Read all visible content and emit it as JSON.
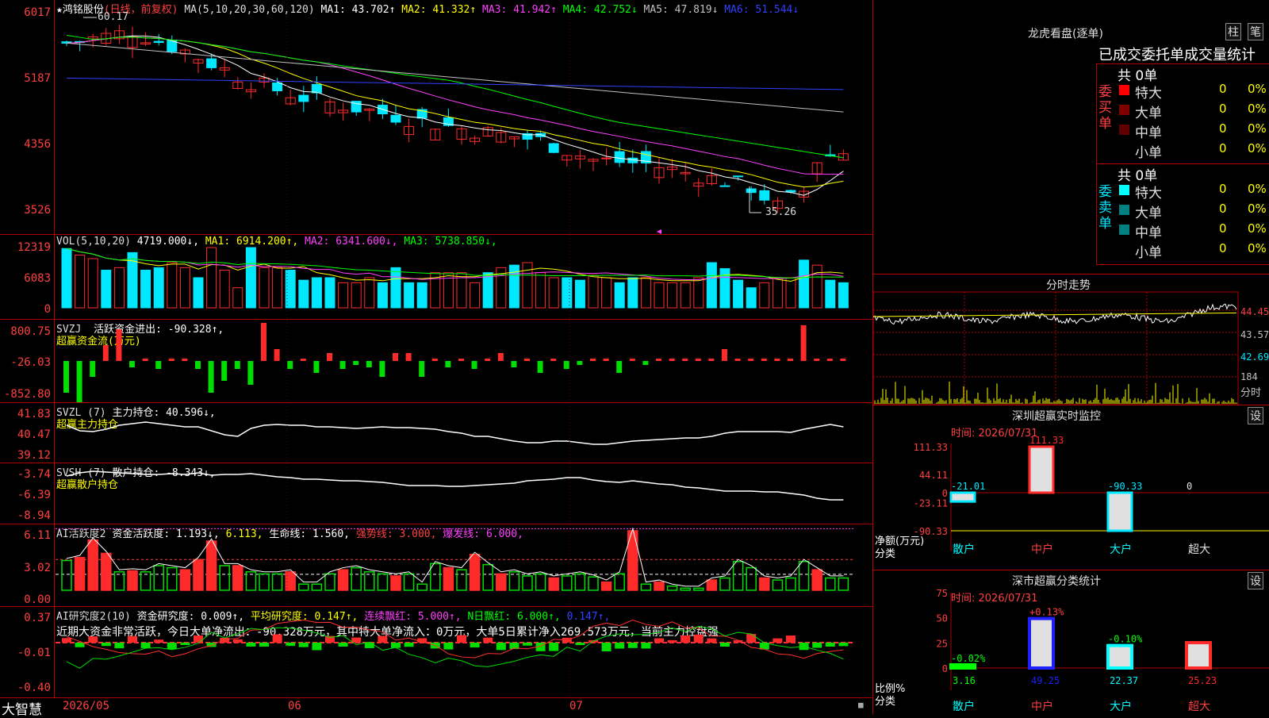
{
  "stock": {
    "name": "鸿铭股份",
    "period": "(日线，前复权)"
  },
  "colors": {
    "up": "#ff2b2b",
    "down": "#00e8ff",
    "bg": "#000000",
    "grid": "#b00000"
  },
  "main": {
    "ma_prefix": "MA(5,10,20,30,60,120)",
    "mas": [
      {
        "label": "MA1: 43.702↑",
        "color": "#ffffff"
      },
      {
        "label": "MA2: 41.332↑",
        "color": "#ffff00"
      },
      {
        "label": "MA3: 41.942↑",
        "color": "#ff40ff"
      },
      {
        "label": "MA4: 42.752↓",
        "color": "#00ff00"
      },
      {
        "label": "MA5: 47.819↓",
        "color": "#c0c0c0"
      },
      {
        "label": "MA6: 51.544↓",
        "color": "#3040ff"
      }
    ],
    "yaxis": [
      "6017",
      "5187",
      "4356",
      "3526"
    ],
    "high_label": "60.17",
    "low_label": "35.26"
  },
  "vol": {
    "prefix": "VOL(5,10,20)",
    "value": "4719.000↓,",
    "ma1": "MA1: 6914.200↑,",
    "ma2": "MA2: 6341.600↓,",
    "ma3": "MA3: 5738.850↓,",
    "yaxis": [
      "12319",
      "6083",
      "0"
    ]
  },
  "svzj": {
    "prefix": "SVZJ",
    "title": "活跃资金进出: -90.328↑,",
    "sub": "超赢资金流(万元)",
    "yaxis": [
      "800.75",
      "-26.03",
      "-852.80"
    ]
  },
  "svzl": {
    "prefix": "SVZL (7)",
    "title": "主力持仓: 40.596↓,",
    "sub": "超赢主力持仓",
    "yaxis": [
      "41.83",
      "40.47",
      "39.12"
    ]
  },
  "svsh": {
    "prefix": "SVSH (7)",
    "title": "散户持仓: -8.343↓,",
    "sub": "超赢散户持仓",
    "yaxis": [
      "-3.74",
      "-6.39",
      "-8.94"
    ]
  },
  "ai2": {
    "prefix": "AI活跃度2",
    "t1": "资金活跃度: 1.193↓,",
    "t2": "6.113,",
    "t3": "生命线: 1.560,",
    "t4": "强势线: 3.000,",
    "t5": "爆发线: 6.000,",
    "yaxis": [
      "6.11",
      "3.02",
      "0.00"
    ]
  },
  "air": {
    "prefix": "AI研究度2(10)",
    "t1": "资金研究度: 0.009↑,",
    "t2": "平均研究度: 0.147↑,",
    "t3": "连续飘红: 5.000↑,",
    "t4": "N日飘红: 6.000↑,",
    "t5": "0.147↑,",
    "comment": "近期大资金非常活跃，今日大单净流出：-90.328万元，其中特大单净流入：0万元，大单5日累计净入269.573万元，当前主力控盘强",
    "yaxis": [
      "0.37",
      "-0.01",
      "-0.40"
    ]
  },
  "xaxis": {
    "brand": "大智慧",
    "labels": [
      "2026/05",
      "06",
      "07"
    ]
  },
  "dragon": {
    "title": "龙虎看盘(逐单)",
    "btn1": "柱",
    "btn2": "笔",
    "subtitle": "已成交委托单成交量统计",
    "buy": {
      "side": "委买单",
      "total": "共 0单",
      "rows": [
        {
          "name": "特大",
          "v": "0",
          "p": "0%"
        },
        {
          "name": "大单",
          "v": "0",
          "p": "0%"
        },
        {
          "name": "中单",
          "v": "0",
          "p": "0%"
        },
        {
          "name": "小单",
          "v": "0",
          "p": "0%"
        }
      ]
    },
    "sell": {
      "side": "委卖单",
      "total": "共 0单",
      "rows": [
        {
          "name": "特大",
          "v": "0",
          "p": "0%"
        },
        {
          "name": "大单",
          "v": "0",
          "p": "0%"
        },
        {
          "name": "中单",
          "v": "0",
          "p": "0%"
        },
        {
          "name": "小单",
          "v": "0",
          "p": "0%"
        }
      ]
    }
  },
  "intraday": {
    "title": "分时走势",
    "yaxis": [
      "44.45",
      "43.57",
      "42.69"
    ],
    "vol_label": "184",
    "unit": "分时"
  },
  "monitor": {
    "title": "深圳超赢实时监控",
    "btn": "设",
    "time": "时间: 2026/07/31",
    "yaxis": [
      "111.33",
      "44.11",
      "0",
      "-23.11",
      "-90.33"
    ],
    "ylabel": "净额(万元)",
    "xlabel": "分类",
    "categories": [
      "散户",
      "中户",
      "大户",
      "超大"
    ],
    "values": [
      -21.01,
      111.33,
      -90.33,
      0
    ],
    "value_labels": [
      "-21.01",
      "111.33",
      "-90.33",
      "0"
    ]
  },
  "classify": {
    "title": "深市超赢分类统计",
    "btn": "设",
    "time": "时间: 2026/07/31",
    "yaxis": [
      "75",
      "50",
      "25",
      "0"
    ],
    "ylabel": "比例%",
    "xlabel": "分类",
    "categories": [
      "散户",
      "中户",
      "大户",
      "超大"
    ],
    "values": [
      3.16,
      49.25,
      22.37,
      25.23
    ],
    "changes": [
      "-0.02%",
      "+0.13%",
      "-0.10%",
      ""
    ]
  }
}
